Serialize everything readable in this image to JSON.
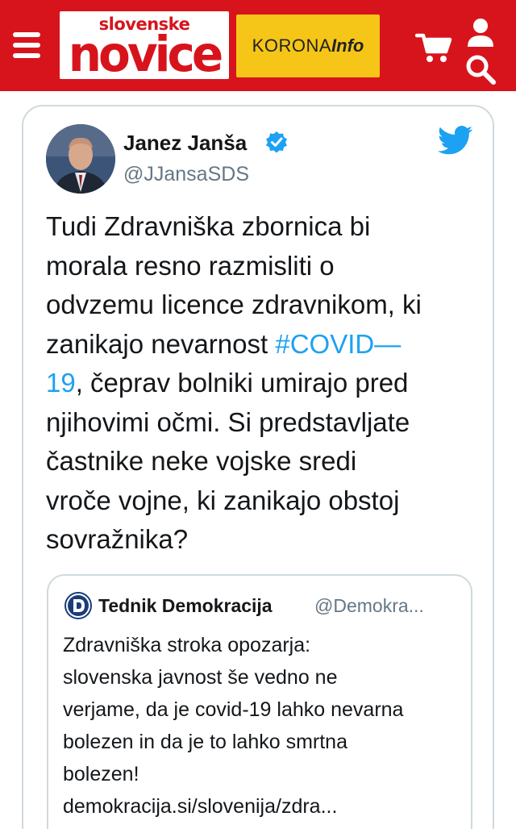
{
  "header": {
    "logo_top": "slovenske",
    "logo_main": "novice",
    "korona_part1": "KORONA",
    "korona_part2": "Info",
    "colors": {
      "header_bg": "#d7141c",
      "korona_bg": "#f5c518"
    },
    "icons": [
      "menu-icon",
      "cart-icon",
      "user-icon",
      "search-icon"
    ]
  },
  "tweet": {
    "author_name": "Janez Janša",
    "author_handle": "@JJansaSDS",
    "text_lines": [
      "Tudi Zdravniška zbornica bi",
      "morala resno razmisliti o",
      "odvzemu licence zdravnikom, ki",
      "zanikajo nevarnost ",
      "#COVID—",
      "19",
      ", čeprav bolniki umirajo pred",
      "njihovimi očmi. Si predstavljate",
      "častnike neke vojske sredi",
      "vroče vojne, ki zanikajo obstoj",
      "sovražnika?"
    ],
    "colors": {
      "hashtag": "#1da1f2",
      "verified": "#1da1f2",
      "handle": "#657786"
    },
    "icons": [
      "verified-badge-icon",
      "twitter-bird-icon"
    ]
  },
  "quote": {
    "name": "Tednik Demokracija",
    "handle": "@Demokra...",
    "lines": [
      "Zdravniška stroka opozarja:",
      "slovenska javnost še vedno ne",
      "verjame, da je covid-19 lahko nevarna",
      "bolezen in da je to lahko smrtna",
      "bolezen!",
      "demokracija.si/slovenija/zdra..."
    ],
    "icons": [
      "demokracija-logo-icon"
    ]
  }
}
